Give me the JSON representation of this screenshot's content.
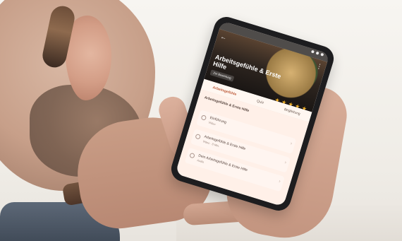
{
  "scene": {
    "description_visible_text": ""
  },
  "phone": {
    "status": {
      "time": "",
      "icons": [
        "signal-icon",
        "wifi-icon",
        "battery-icon"
      ]
    },
    "hero": {
      "title": "Arbeitsgefühle & Erste Hilfe",
      "badge": "Zur Bewertung",
      "back_icon": "←",
      "more_icon": "⋮",
      "rating_stars": 5
    },
    "tabs": [
      "Arbeitsgefühle",
      "Quiz",
      "Begleitung"
    ],
    "content": {
      "section_title": "Arbeitsgefühle & Erste Hilfe",
      "section_sub": "",
      "items": [
        {
          "title": "Einführung",
          "sub": "Video"
        },
        {
          "title": "Arbeitsgefühle & Erste Hilfe",
          "sub": "Video · 8 Min."
        },
        {
          "title": "Dein Arbeitsgefühle & Erste Hilfe",
          "sub": "Audio"
        }
      ]
    }
  }
}
